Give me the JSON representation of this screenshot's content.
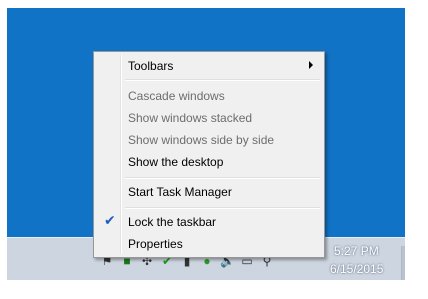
{
  "menu": {
    "items": [
      {
        "label": "Toolbars",
        "submenu": true,
        "enabled": true,
        "checked": false
      },
      {
        "label": "Cascade windows",
        "enabled": false,
        "checked": false
      },
      {
        "label": "Show windows stacked",
        "enabled": false,
        "checked": false
      },
      {
        "label": "Show windows side by side",
        "enabled": false,
        "checked": false
      },
      {
        "label": "Show the desktop",
        "enabled": true,
        "checked": false
      },
      {
        "label": "Start Task Manager",
        "enabled": true,
        "checked": false
      },
      {
        "label": "Lock the taskbar",
        "enabled": true,
        "checked": true
      },
      {
        "label": "Properties",
        "enabled": true,
        "checked": false
      }
    ]
  },
  "tray": {
    "icons": [
      "flag-icon",
      "security-icon",
      "network-icon",
      "shield-check-icon",
      "battery-icon",
      "antivirus-icon",
      "volume-icon",
      "display-icon",
      "usb-icon"
    ]
  },
  "clock": {
    "time": "5:27 PM",
    "date": "6/15/2015"
  },
  "colors": {
    "desktop": "#1173c6",
    "taskbar": "#cdd5e0",
    "menu_bg": "#f0f0f0",
    "check": "#1f5fc0"
  }
}
